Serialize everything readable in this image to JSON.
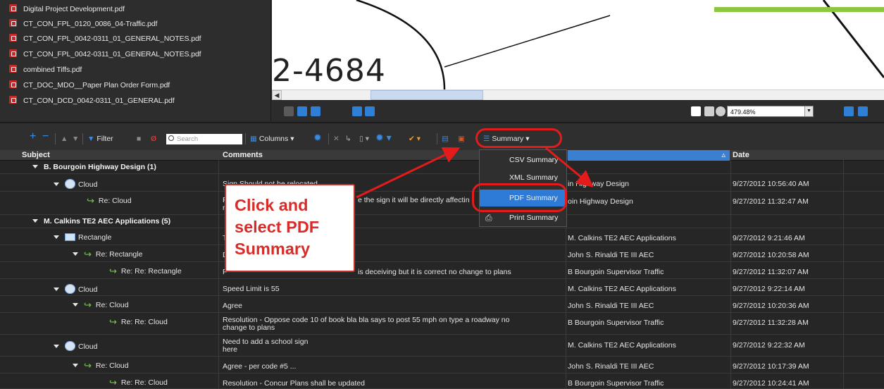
{
  "files": [
    "Digital Project Development.pdf",
    "CT_CON_FPL_0120_0086_04-Traffic.pdf",
    "CT_CON_FPL_0042-0311_01_GENERAL_NOTES.pdf",
    "CT_CON_FPL_0042-0311_01_GENERAL_NOTES.pdf",
    "combined Tiffs.pdf",
    "CT_DOC_MDO__Paper Plan Order Form.pdf",
    "CT_CON_DCD_0042-0311_01_GENERAL.pdf"
  ],
  "drawing_text": "2-4684",
  "zoom_value": "479.48%",
  "toolbar": {
    "filter_label": "Filter",
    "search_placeholder": "Search",
    "columns_label": "Columns",
    "summary_label": "Summary"
  },
  "menu": {
    "items": [
      "CSV Summary",
      "XML Summary",
      "PDF Summary",
      "Print Summary"
    ],
    "active": "PDF Summary"
  },
  "columns": {
    "subject": "Subject",
    "comments": "Comments",
    "date": "Date"
  },
  "groups": [
    {
      "label": "B. Bourgoin Highway Design (1)"
    },
    {
      "label": "M. Calkins TE2 AEC Applications (5)"
    }
  ],
  "rows": [
    {
      "subject": "Cloud",
      "comment": "Sign Should not be relocated",
      "author": "in Highway Design",
      "date": "9/27/2012 10:56:40 AM"
    },
    {
      "subject": "Re: Cloud",
      "comment": "e the sign it will be directly affectin",
      "comment2": "m",
      "author": "oin Highway Design",
      "date": "9/27/2012 11:32:47 AM"
    },
    {
      "subject": "Rectangle",
      "comment": "T",
      "author": "M. Calkins TE2 AEC Applications",
      "date": "9/27/2012 9:21:46 AM"
    },
    {
      "subject": "Re: Rectangle",
      "comment": "D",
      "author": "John S. Rinaldi TE III AEC",
      "date": "9/27/2012 10:20:58 AM"
    },
    {
      "subject": "Re: Re: Rectangle",
      "comment": "F",
      "comment_tail": "is deceiving but it is correct no change to plans",
      "author": "B Bourgoin Supervisor Traffic",
      "date": "9/27/2012 11:32:07 AM"
    },
    {
      "subject": "Cloud",
      "comment": "Speed Limit is 55",
      "author": "M. Calkins TE2 AEC Applications",
      "date": "9/27/2012 9:22:14 AM"
    },
    {
      "subject": "Re: Cloud",
      "comment": "Agree",
      "author": "John S. Rinaldi TE III AEC",
      "date": "9/27/2012 10:20:36 AM"
    },
    {
      "subject": "Re: Re: Cloud",
      "comment": "Resolution - Oppose code 10 of book bla bla says to post 55 mph on type a roadway no",
      "comment2": "change to plans",
      "author": "B Bourgoin Supervisor Traffic",
      "date": "9/27/2012 11:32:28 AM"
    },
    {
      "subject": "Cloud",
      "comment": "Need to add a school sign",
      "comment2": "here",
      "author": "M. Calkins TE2 AEC Applications",
      "date": "9/27/2012 9:22:32 AM"
    },
    {
      "subject": "Re: Cloud",
      "comment": "Agree - per code #5 ...",
      "author": "John S. Rinaldi TE III AEC",
      "date": "9/27/2012 10:17:39 AM"
    },
    {
      "subject": "Re: Re: Cloud",
      "comment": "Resolution - Concur Plans shall be updated",
      "author": "B Bourgoin Supervisor Traffic",
      "date": "9/27/2012 10:24:41 AM"
    }
  ],
  "callout_text": "Click and select PDF Summary",
  "colors": {
    "highlight_red": "#e31b1b",
    "menu_active_blue": "#2e7bd7",
    "sort_header_blue": "#3b7fd0"
  }
}
